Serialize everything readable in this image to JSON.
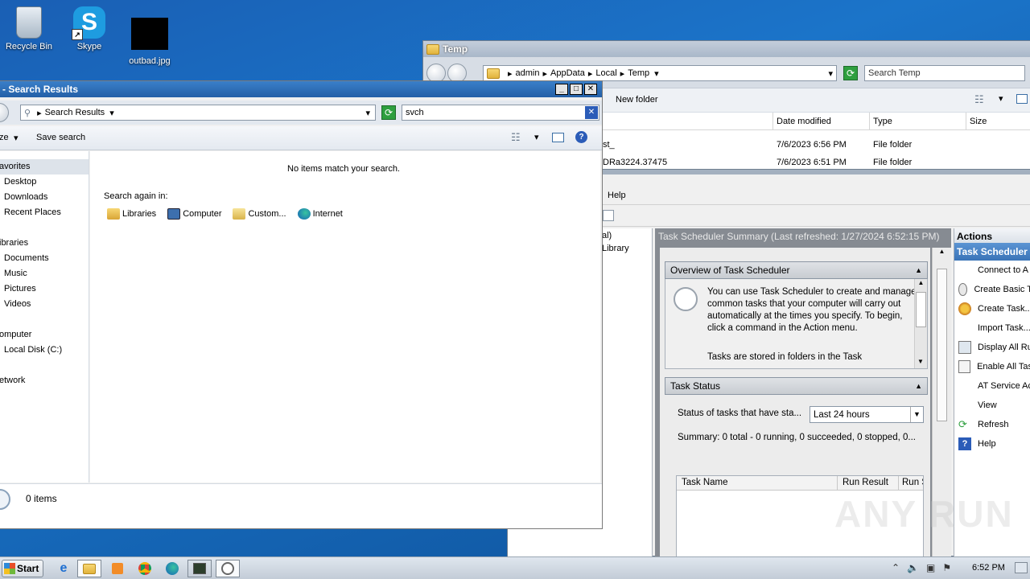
{
  "desktop": {
    "icons": [
      {
        "label": "Recycle Bin"
      },
      {
        "label": "Skype"
      },
      {
        "label": "outbad.jpg"
      }
    ]
  },
  "search_window": {
    "title": "- Search Results",
    "breadcrumb": "Search Results",
    "search_value": "svch",
    "toolbar": {
      "organize_label": "ze",
      "save_search_label": "Save search"
    },
    "sidebar": {
      "favorites": "avorites",
      "favorite_items": [
        "Desktop",
        "Downloads",
        "Recent Places"
      ],
      "libraries": "ibraries",
      "library_items": [
        "Documents",
        "Music",
        "Pictures",
        "Videos"
      ],
      "computer": "omputer",
      "computer_items": [
        "Local Disk (C:)"
      ],
      "network": "etwork"
    },
    "no_items_message": "No items match your search.",
    "search_again_label": "Search again in:",
    "search_again_locations": [
      "Libraries",
      "Computer",
      "Custom...",
      "Internet"
    ],
    "status_text": "0 items"
  },
  "temp_window": {
    "title": "Temp",
    "breadcrumb": [
      "admin",
      "AppData",
      "Local",
      "Temp"
    ],
    "search_placeholder": "Search Temp",
    "new_folder_label": "New folder",
    "columns": [
      "Date modified",
      "Type",
      "Size"
    ],
    "rows": [
      {
        "name": "st_",
        "date": "7/6/2023 6:56 PM",
        "type": "File folder"
      },
      {
        "name": "DRa3224.37475",
        "date": "7/6/2023 6:51 PM",
        "type": "File folder"
      }
    ]
  },
  "task_scheduler": {
    "menu_help": "Help",
    "tree_items": [
      "al)",
      "Library"
    ],
    "summary_header": "Task Scheduler Summary (Last refreshed: 1/27/2024 6:52:15 PM)",
    "overview_title": "Overview of Task Scheduler",
    "overview_text": "You can use Task Scheduler to create and manage common tasks that your computer will carry out automatically at the times you specify. To begin, click a command in the Action menu.",
    "overview_text2": "Tasks are stored in folders in the Task",
    "status_title": "Task Status",
    "status_label": "Status of tasks that have sta...",
    "status_select": "Last 24 hours",
    "summary_line": "Summary: 0 total - 0 running, 0 succeeded, 0 stopped, 0...",
    "table_columns": [
      "Task Name",
      "Run Result",
      "Run S"
    ],
    "actions_title": "Actions",
    "actions_section": "Task Scheduler",
    "actions": [
      {
        "label": "Connect to A",
        "icon": "none"
      },
      {
        "label": "Create Basic T",
        "icon": "wizard-icon"
      },
      {
        "label": "Create Task...",
        "icon": "task-icon"
      },
      {
        "label": "Import Task...",
        "icon": "none"
      },
      {
        "label": "Display All Ru",
        "icon": "display-icon"
      },
      {
        "label": "Enable All Tas",
        "icon": "enable-icon"
      },
      {
        "label": "AT Service Ac",
        "icon": "none"
      },
      {
        "label": "View",
        "icon": "none"
      },
      {
        "label": "Refresh",
        "icon": "refresh-icon"
      },
      {
        "label": "Help",
        "icon": "help-icon"
      }
    ]
  },
  "taskbar": {
    "start_label": "Start",
    "clock": "6:52 PM"
  },
  "watermark": "ANY RUN"
}
